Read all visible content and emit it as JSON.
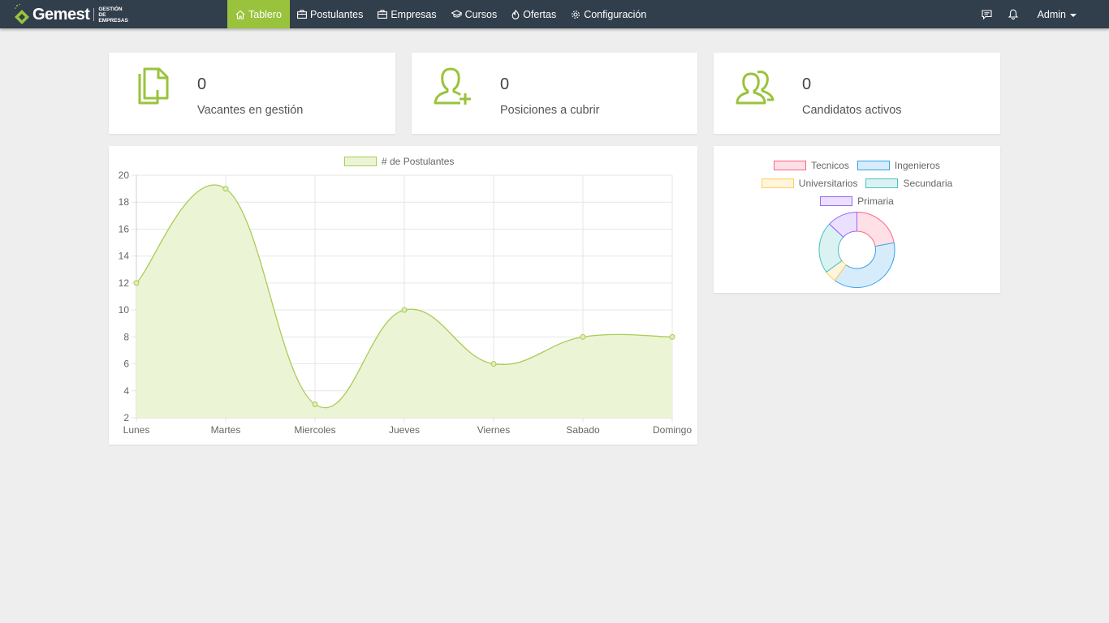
{
  "brand": {
    "name": "Gemest",
    "subtitle_line1": "GESTIÓN DE",
    "subtitle_line2": "EMPRESAS"
  },
  "nav": {
    "items": [
      {
        "label": "Tablero",
        "icon": "home-icon",
        "active": true
      },
      {
        "label": "Postulantes",
        "icon": "briefcase-icon"
      },
      {
        "label": "Empresas",
        "icon": "briefcase-icon"
      },
      {
        "label": "Cursos",
        "icon": "graduation-cap-icon"
      },
      {
        "label": "Ofertas",
        "icon": "fire-icon"
      },
      {
        "label": "Configuración",
        "icon": "gear-icon"
      }
    ],
    "right": {
      "messages_icon": "comment-icon",
      "notifications_icon": "bell-icon",
      "user": "Admin"
    }
  },
  "stats": [
    {
      "value": "0",
      "label": "Vacantes en gestión",
      "icon": "documents-icon"
    },
    {
      "value": "0",
      "label": "Posiciones a cubrir",
      "icon": "user-add-icon"
    },
    {
      "value": "0",
      "label": "Candidatos activos",
      "icon": "users-icon"
    }
  ],
  "colors": {
    "accent": "#99c33c",
    "navbar": "#313e4b",
    "background": "#efeeee"
  },
  "chart_data": [
    {
      "type": "area",
      "categories": [
        "Lunes",
        "Martes",
        "Miercoles",
        "Jueves",
        "Viernes",
        "Sabado",
        "Domingo"
      ],
      "series": [
        {
          "name": "# de Postulantes",
          "values": [
            12,
            19,
            3,
            10,
            6,
            8,
            8
          ],
          "color": "#a9cc55"
        }
      ],
      "ylim": [
        2,
        20
      ],
      "yticks": [
        "20",
        "18",
        "16",
        "14",
        "12",
        "10",
        "8",
        "6",
        "4",
        "2"
      ],
      "grid": true,
      "legend": "top-center"
    },
    {
      "type": "pie",
      "labels": [
        "Tecnicos",
        "Ingenieros",
        "Universitarios",
        "Secundaria",
        "Primaria"
      ],
      "values": [
        22,
        38,
        5,
        22,
        13
      ],
      "colors": [
        "#ff6384",
        "#36a2eb",
        "#ffce56",
        "#4bc0c0",
        "#9966ff"
      ],
      "fills": [
        "#ffe0e6",
        "#d7ecfb",
        "#fff5dd",
        "#dbf2f2",
        "#ebe0ff"
      ],
      "legend": "top"
    }
  ]
}
